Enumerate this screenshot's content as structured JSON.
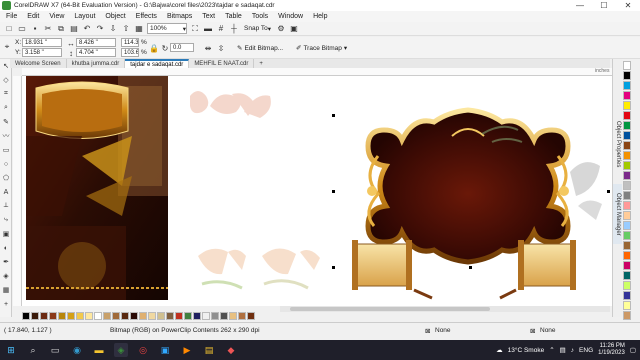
{
  "window": {
    "title": "CorelDRAW X7 (64-Bit Evaluation Version) - G:\\Bajwa\\corel files\\2023\\tajdar e sadaqat.cdr",
    "minimize": "—",
    "maximize": "☐",
    "close": "✕"
  },
  "menu": [
    "File",
    "Edit",
    "View",
    "Layout",
    "Object",
    "Effects",
    "Bitmaps",
    "Text",
    "Table",
    "Tools",
    "Window",
    "Help"
  ],
  "toolbar": {
    "zoom_value": "100%",
    "snap_label": "Snap To"
  },
  "propbar": {
    "x_label": "X:",
    "x_value": "18.931 \"",
    "y_label": "Y:",
    "y_value": "3.158 \"",
    "w_value": "8.426 \"",
    "h_value": "4.704 \"",
    "scale_w": "114.3",
    "scale_h": "103.6",
    "pct": "%",
    "angle_value": "0.0",
    "edit_bitmap": "Edit Bitmap...",
    "trace_bitmap": "Trace Bitmap"
  },
  "tabs": [
    {
      "label": "Welcome Screen",
      "active": false
    },
    {
      "label": "khutba jumma.cdr",
      "active": false
    },
    {
      "label": "tajdar e sadaqat.cdr",
      "active": true
    },
    {
      "label": "MEHFIL E NAAT.cdr",
      "active": false
    }
  ],
  "ruler_unit": "inches",
  "dockers": [
    "Object Properties",
    "Object Manager"
  ],
  "palette_colors": [
    "#ffffff",
    "#000000",
    "#00a0e0",
    "#e4007f",
    "#ffed00",
    "#e30613",
    "#009640",
    "#00519e",
    "#8b4513",
    "#f39200",
    "#a3c900",
    "#7b2a8a",
    "#c0c0c0",
    "#808080",
    "#ff9999",
    "#ffcc99",
    "#99ccff",
    "#66cc66",
    "#996633",
    "#ff6600",
    "#cc0066",
    "#006666",
    "#ccff66",
    "#333399",
    "#ffff99",
    "#cc9966"
  ],
  "doc_palette": [
    "#000000",
    "#3a1a0a",
    "#6b2a12",
    "#8b3a1a",
    "#b8860b",
    "#d4a017",
    "#f2c94c",
    "#ffe8a0",
    "#ffffff",
    "#c8a06a",
    "#a06a3a",
    "#5a2a10",
    "#2a0a05",
    "#e0b070",
    "#f0d8a0",
    "#d0c090",
    "#806040",
    "#c03020",
    "#408040",
    "#202060",
    "#f0f0f0",
    "#909090",
    "#505050",
    "#e8c080",
    "#b07040",
    "#703010"
  ],
  "status": {
    "coords": "( 17.840, 1.127 )",
    "object_info": "Bitmap (RGB) on PowerClip Contents 262 x 290 dpi",
    "fill_label": "None",
    "outline_label": "None"
  },
  "taskbar": {
    "weather": "13°C  Smoke",
    "lang": "ENG",
    "time": "11:26 PM",
    "date": "1/19/2023"
  }
}
